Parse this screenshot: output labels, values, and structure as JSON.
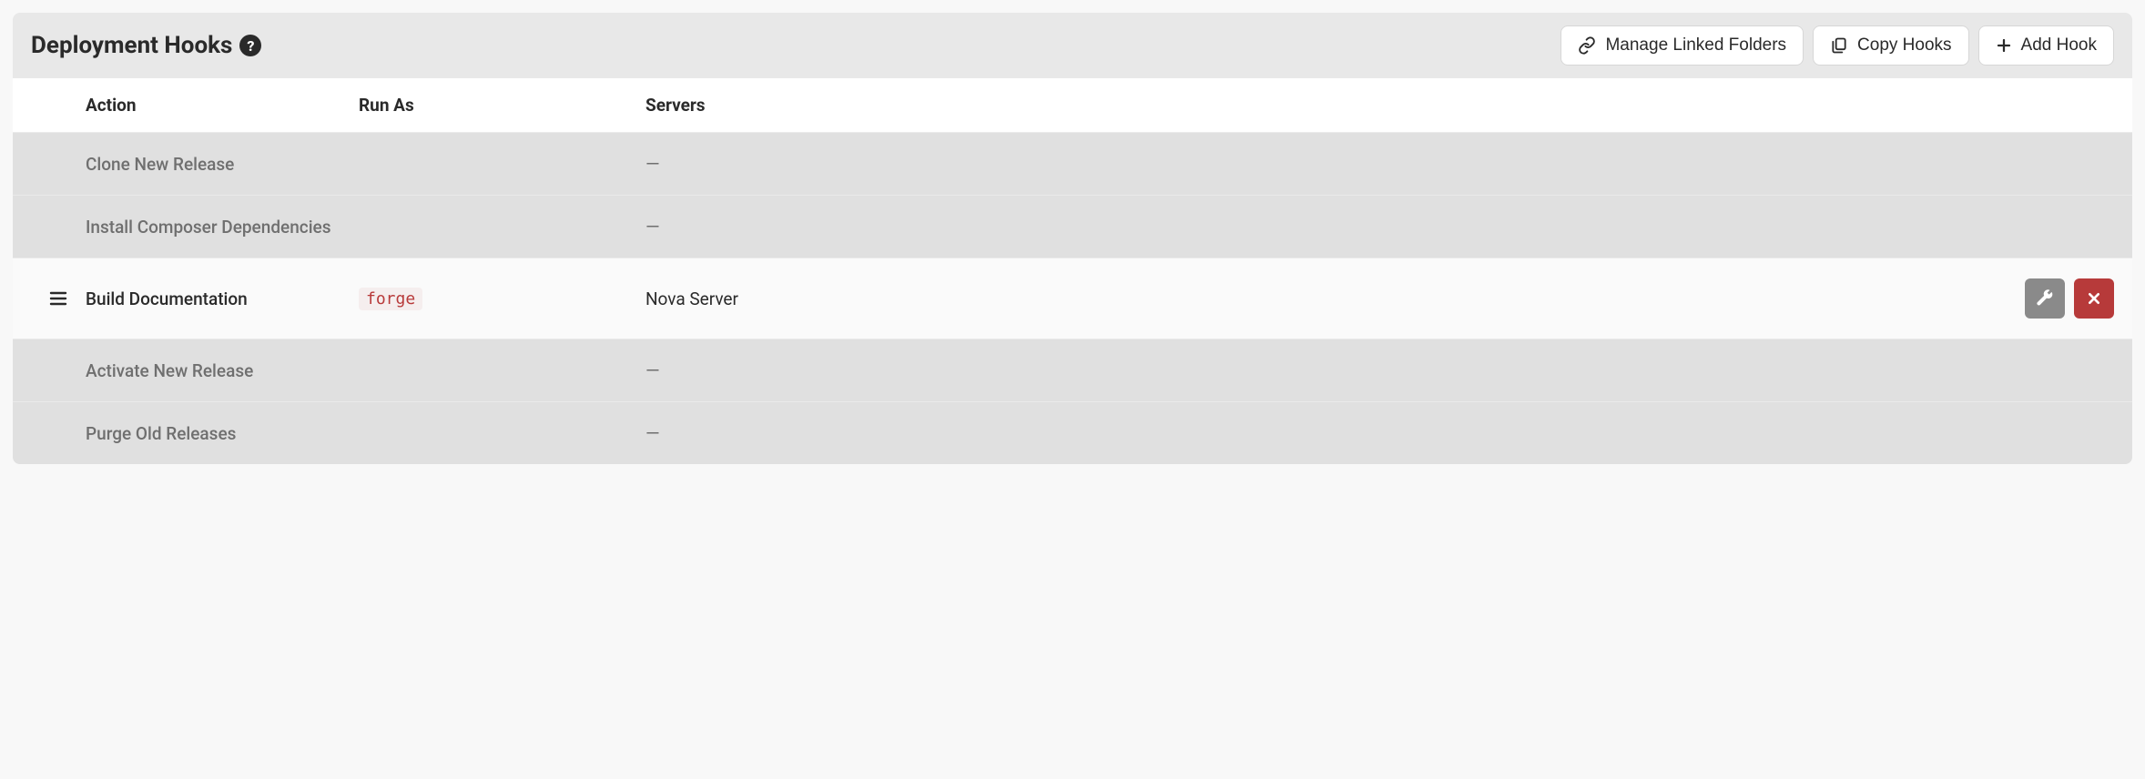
{
  "header": {
    "title": "Deployment Hooks",
    "buttons": {
      "manage_linked_folders": "Manage Linked Folders",
      "copy_hooks": "Copy Hooks",
      "add_hook": "Add Hook"
    }
  },
  "table": {
    "columns": {
      "action": "Action",
      "run_as": "Run As",
      "servers": "Servers"
    },
    "rows": [
      {
        "type": "system",
        "action": "Clone New Release",
        "run_as": "",
        "servers": "—"
      },
      {
        "type": "system",
        "action": "Install Composer Dependencies",
        "run_as": "",
        "servers": "—"
      },
      {
        "type": "custom",
        "action": "Build Documentation",
        "run_as": "forge",
        "servers": "Nova Server"
      },
      {
        "type": "system",
        "action": "Activate New Release",
        "run_as": "",
        "servers": "—"
      },
      {
        "type": "system",
        "action": "Purge Old Releases",
        "run_as": "",
        "servers": "—"
      }
    ]
  }
}
